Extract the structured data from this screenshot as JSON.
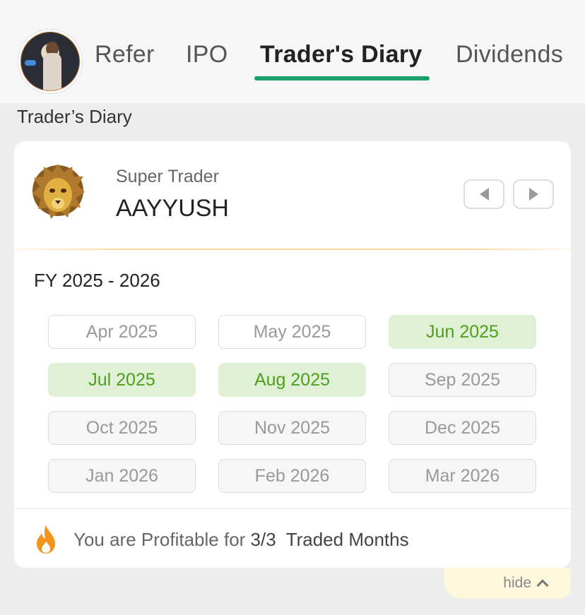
{
  "nav": {
    "tabs": [
      {
        "label": "Refer"
      },
      {
        "label": "IPO"
      },
      {
        "label": "Trader's Diary"
      },
      {
        "label": "Dividends"
      }
    ],
    "active_tab": "Trader's Diary",
    "accent_color": "#1aa06a"
  },
  "section_title": "Trader’s Diary",
  "card": {
    "badge_label": "Super Trader",
    "trader_name": "AAYYUSH",
    "fy_label": "FY 2025 - 2026",
    "months": [
      {
        "label": "Apr 2025",
        "status": "not-profitable"
      },
      {
        "label": "May 2025",
        "status": "not-profitable"
      },
      {
        "label": "Jun 2025",
        "status": "profitable"
      },
      {
        "label": "Jul 2025",
        "status": "profitable"
      },
      {
        "label": "Aug 2025",
        "status": "profitable"
      },
      {
        "label": "Sep 2025",
        "status": "future"
      },
      {
        "label": "Oct 2025",
        "status": "future"
      },
      {
        "label": "Nov 2025",
        "status": "future"
      },
      {
        "label": "Dec 2025",
        "status": "future"
      },
      {
        "label": "Jan 2026",
        "status": "future"
      },
      {
        "label": "Feb 2026",
        "status": "future"
      },
      {
        "label": "Mar 2026",
        "status": "future"
      }
    ],
    "summary_prefix": "You are Profitable for",
    "summary_count": "3/3",
    "summary_suffix": "Traded Months",
    "profit_color": "#4ca01e"
  },
  "hide_label": "hide",
  "icons": [
    "avatar",
    "lion-icon",
    "prev-arrow-icon",
    "next-arrow-icon",
    "flame-icon",
    "chevron-up-icon"
  ]
}
